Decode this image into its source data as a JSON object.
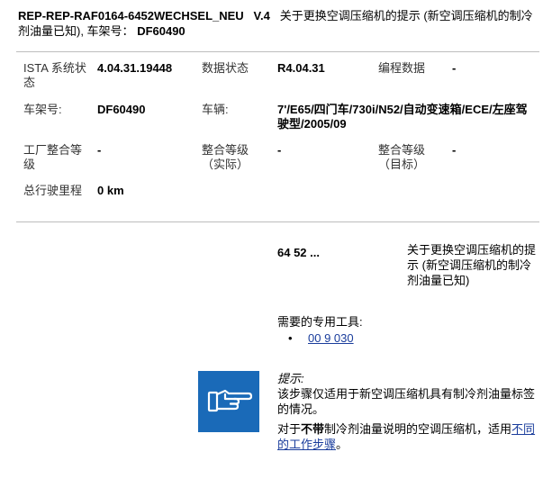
{
  "header": {
    "title_code": "REP-REP-RAF0164-6452WECHSEL_NEU",
    "version": "V.4",
    "title_text": "关于更换空调压缩机的提示 (新空调压缩机的制冷剂油量已知), 车架号：",
    "vin": "DF60490"
  },
  "info": {
    "ista_label": "ISTA 系统状态",
    "ista_value": "4.04.31.19448",
    "data_status_label": "数据状态",
    "data_status_value": "R4.04.31",
    "program_data_label": "编程数据",
    "program_data_value": "-",
    "vin_label": "车架号:",
    "vin_value": "DF60490",
    "vehicle_label": "车辆:",
    "vehicle_value": "7'/E65/四门车/730i/N52/自动变速箱/ECE/左座驾驶型/2005/09",
    "factory_level_label": "工厂整合等级",
    "factory_level_value": "-",
    "actual_level_label": "整合等级（实际）",
    "actual_level_value": "-",
    "target_level_label": "整合等级（目标）",
    "target_level_value": "-",
    "mileage_label": "总行驶里程",
    "mileage_value": "0 km"
  },
  "step": {
    "code": "64 52 ...",
    "description": "关于更换空调压缩机的提示 (新空调压缩机的制冷剂油量已知)"
  },
  "tools": {
    "heading": "需要的专用工具:",
    "items": [
      {
        "bullet": "•",
        "label": "00 9 030"
      }
    ]
  },
  "note": {
    "icon": "pointing-hand-icon",
    "label": "提示:",
    "line1": "该步骤仅适用于新空调压缩机具有制冷剂油量标签的情况。",
    "line2_a": "对于",
    "line2_bold": "不带",
    "line2_b": "制冷剂油量说明的空调压缩机，适用",
    "line2_link": "不同的工作步骤",
    "line2_end": "。"
  },
  "colors": {
    "icon_bg": "#1a6ab8",
    "link": "#1a3d9c",
    "divider": "#bdbdbd"
  }
}
